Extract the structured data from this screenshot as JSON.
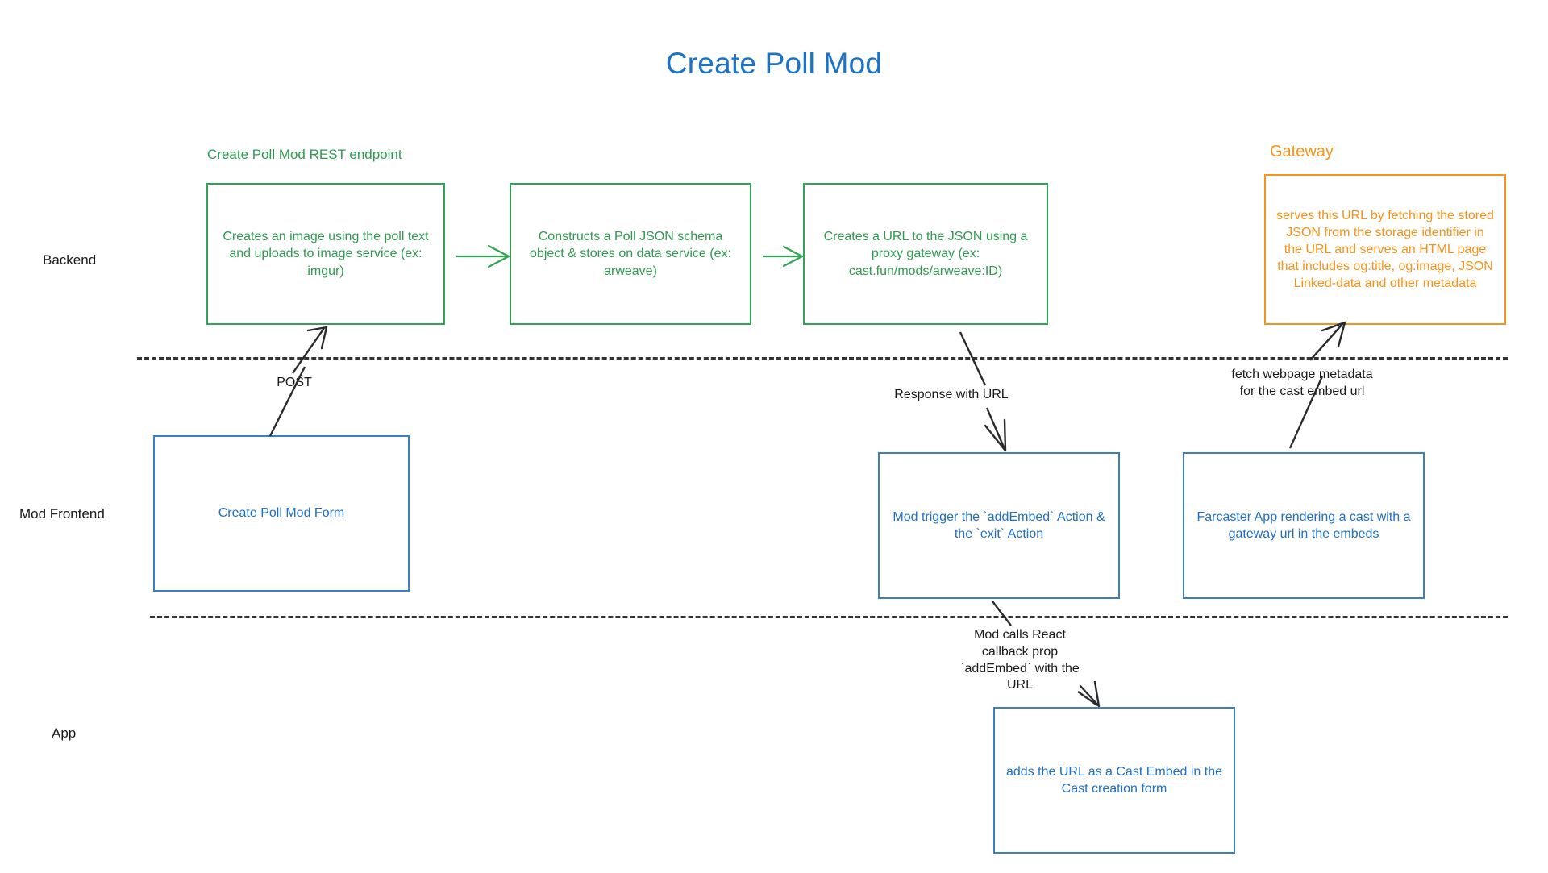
{
  "title": "Create Poll Mod",
  "colors": {
    "title_blue": "#1a73c8",
    "green": "#2e9b4f",
    "orange": "#f59219",
    "blue": "#1f6fc4",
    "divider": "#333333"
  },
  "lanes": [
    {
      "id": "backend",
      "label": "Backend"
    },
    {
      "id": "frontend",
      "label": "Mod Frontend"
    },
    {
      "id": "app",
      "label": "App"
    }
  ],
  "captions": {
    "rest_endpoint": "Create Poll Mod REST endpoint",
    "gateway": "Gateway"
  },
  "nodes": {
    "create_image": "Creates an image using the poll text and uploads to image service (ex: imgur)",
    "construct_json": "Constructs a Poll JSON schema object & stores on data service (ex: arweave)",
    "create_url": "Creates a URL to the JSON using a proxy gateway (ex: cast.fun/mods/arweave:ID)",
    "gateway_serve": "serves this URL by fetching the stored JSON from the storage identifier in the URL and serves an HTML page that includes og:title, og:image, JSON Linked-data and other metadata",
    "create_form": "Create Poll Mod Form",
    "mod_trigger": "Mod trigger the `addEmbed` Action & the `exit` Action",
    "farcaster_app": "Farcaster App rendering a cast with a gateway url in the embeds",
    "cast_embed": "adds the URL as a Cast Embed in the Cast creation form"
  },
  "edges": {
    "post": "POST",
    "response_with_url": "Response with URL",
    "fetch_metadata": "fetch webpage metadata\nfor the cast embed url",
    "react_callback": "Mod calls React\ncallback prop\n`addEmbed` with the\nURL"
  }
}
